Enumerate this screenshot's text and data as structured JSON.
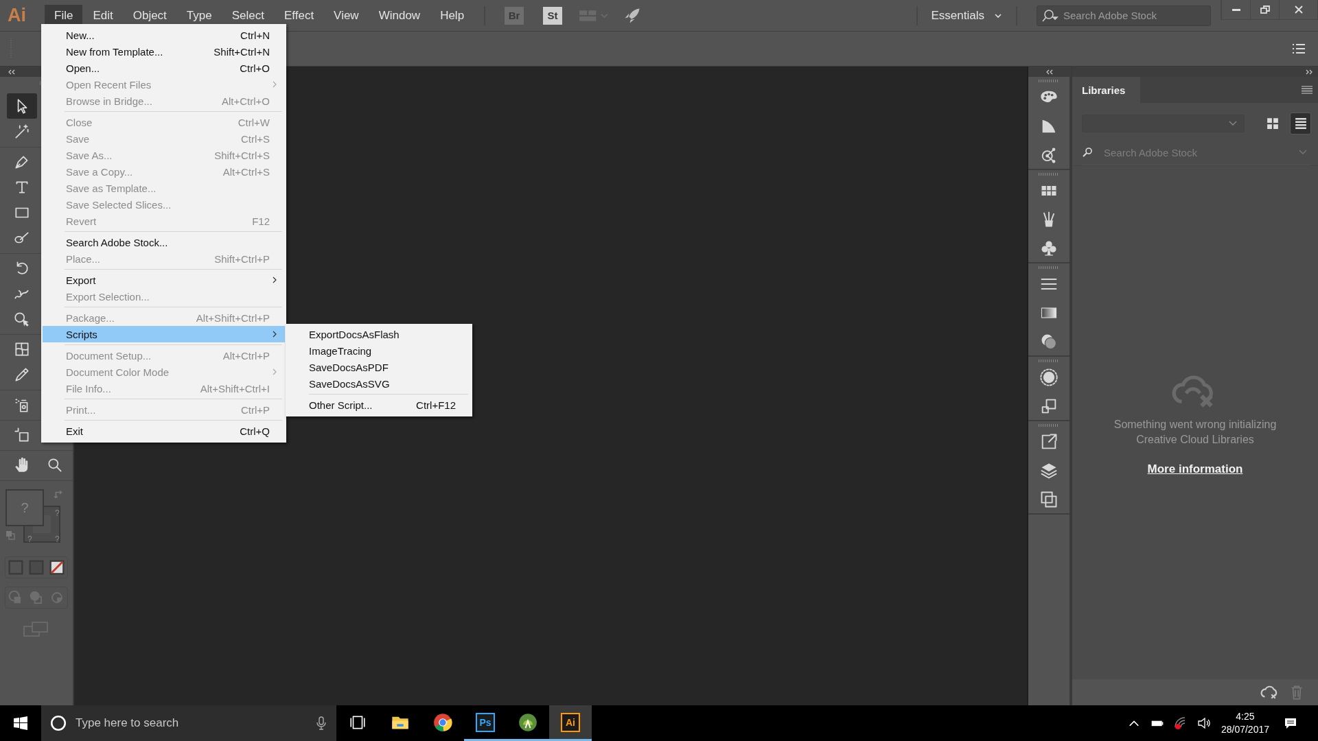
{
  "app_logo": "Ai",
  "menu_bar": [
    {
      "label": "File",
      "selected": true
    },
    {
      "label": "Edit",
      "selected": false
    },
    {
      "label": "Object",
      "selected": false
    },
    {
      "label": "Type",
      "selected": false
    },
    {
      "label": "Select",
      "selected": false
    },
    {
      "label": "Effect",
      "selected": false
    },
    {
      "label": "View",
      "selected": false
    },
    {
      "label": "Window",
      "selected": false
    },
    {
      "label": "Help",
      "selected": false
    }
  ],
  "app_buttons": [
    {
      "label": "Br",
      "disabled": true
    },
    {
      "label": "St",
      "disabled": false
    }
  ],
  "workspace": {
    "label": "Essentials"
  },
  "stock_search": {
    "placeholder": "Search Adobe Stock"
  },
  "tool_groups": [
    [
      {
        "kind": "selection",
        "selected": true
      },
      {
        "kind": "magic-wand",
        "selected": false
      }
    ],
    [
      {
        "kind": "pen",
        "selected": false
      },
      {
        "kind": "type",
        "selected": false
      },
      {
        "kind": "rectangle",
        "selected": false
      },
      {
        "kind": "brush",
        "selected": false
      }
    ],
    [
      {
        "kind": "rotate",
        "selected": false
      },
      {
        "kind": "warp",
        "selected": false
      },
      {
        "kind": "shape-builder",
        "selected": false
      }
    ],
    [
      {
        "kind": "mesh",
        "selected": false
      },
      {
        "kind": "eyedropper",
        "selected": false
      }
    ],
    [
      {
        "kind": "sprayer",
        "selected": false
      }
    ],
    [
      {
        "kind": "artboard",
        "selected": false
      }
    ]
  ],
  "nav_tools": [
    {
      "kind": "hand",
      "selected": false
    },
    {
      "kind": "zoom",
      "selected": false
    }
  ],
  "fill_stroke": {
    "fill_label": "?",
    "stroke_labels": [
      "?",
      "?",
      "?"
    ]
  },
  "file_menu": [
    {
      "kind": "item",
      "label": "New...",
      "shortcut": "Ctrl+N",
      "disabled": false,
      "selected": false
    },
    {
      "kind": "item",
      "label": "New from Template...",
      "shortcut": "Shift+Ctrl+N",
      "disabled": false,
      "selected": false
    },
    {
      "kind": "item",
      "label": "Open...",
      "shortcut": "Ctrl+O",
      "disabled": false,
      "selected": false
    },
    {
      "kind": "submenu",
      "label": "Open Recent Files",
      "disabled": true,
      "selected": false
    },
    {
      "kind": "item",
      "label": "Browse in Bridge...",
      "shortcut": "Alt+Ctrl+O",
      "disabled": true,
      "selected": false
    },
    {
      "kind": "separator"
    },
    {
      "kind": "item",
      "label": "Close",
      "shortcut": "Ctrl+W",
      "disabled": true,
      "selected": false
    },
    {
      "kind": "item",
      "label": "Save",
      "shortcut": "Ctrl+S",
      "disabled": true,
      "selected": false
    },
    {
      "kind": "item",
      "label": "Save As...",
      "shortcut": "Shift+Ctrl+S",
      "disabled": true,
      "selected": false
    },
    {
      "kind": "item",
      "label": "Save a Copy...",
      "shortcut": "Alt+Ctrl+S",
      "disabled": true,
      "selected": false
    },
    {
      "kind": "item",
      "label": "Save as Template...",
      "disabled": true,
      "selected": false
    },
    {
      "kind": "item",
      "label": "Save Selected Slices...",
      "disabled": true,
      "selected": false
    },
    {
      "kind": "item",
      "label": "Revert",
      "shortcut": "F12",
      "disabled": true,
      "selected": false
    },
    {
      "kind": "separator"
    },
    {
      "kind": "item",
      "label": "Search Adobe Stock...",
      "disabled": false,
      "selected": false
    },
    {
      "kind": "item",
      "label": "Place...",
      "shortcut": "Shift+Ctrl+P",
      "disabled": true,
      "selected": false
    },
    {
      "kind": "separator"
    },
    {
      "kind": "submenu",
      "label": "Export",
      "disabled": false,
      "selected": false
    },
    {
      "kind": "item",
      "label": "Export Selection...",
      "disabled": true,
      "selected": false
    },
    {
      "kind": "separator"
    },
    {
      "kind": "item",
      "label": "Package...",
      "shortcut": "Alt+Shift+Ctrl+P",
      "disabled": true,
      "selected": false
    },
    {
      "kind": "submenu",
      "label": "Scripts",
      "disabled": false,
      "selected": true
    },
    {
      "kind": "separator"
    },
    {
      "kind": "item",
      "label": "Document Setup...",
      "shortcut": "Alt+Ctrl+P",
      "disabled": true,
      "selected": false
    },
    {
      "kind": "submenu",
      "label": "Document Color Mode",
      "disabled": true,
      "selected": false
    },
    {
      "kind": "item",
      "label": "File Info...",
      "shortcut": "Alt+Shift+Ctrl+I",
      "disabled": true,
      "selected": false
    },
    {
      "kind": "separator"
    },
    {
      "kind": "item",
      "label": "Print...",
      "shortcut": "Ctrl+P",
      "disabled": true,
      "selected": false
    },
    {
      "kind": "separator"
    },
    {
      "kind": "item",
      "label": "Exit",
      "shortcut": "Ctrl+Q",
      "disabled": false,
      "selected": false
    }
  ],
  "scripts_menu": [
    {
      "kind": "item",
      "label": "ExportDocsAsFlash"
    },
    {
      "kind": "item",
      "label": "ImageTracing"
    },
    {
      "kind": "item",
      "label": "SaveDocsAsPDF"
    },
    {
      "kind": "item",
      "label": "SaveDocsAsSVG"
    },
    {
      "kind": "separator"
    },
    {
      "kind": "item",
      "label": "Other Script...",
      "shortcut": "Ctrl+F12"
    }
  ],
  "dock_groups": [
    [
      {
        "kind": "palette"
      },
      {
        "kind": "fan"
      },
      {
        "kind": "nodes"
      }
    ],
    [
      {
        "kind": "swatches"
      },
      {
        "kind": "brushes"
      },
      {
        "kind": "club"
      }
    ],
    [
      {
        "kind": "lines"
      },
      {
        "kind": "gradient"
      },
      {
        "kind": "circles"
      }
    ],
    [
      {
        "kind": "dotted-circle"
      },
      {
        "kind": "squares"
      }
    ],
    [
      {
        "kind": "export"
      },
      {
        "kind": "layers"
      },
      {
        "kind": "artboards"
      }
    ]
  ],
  "libraries": {
    "tab": "Libraries",
    "search_placeholder": "Search Adobe Stock",
    "view_buttons": [
      {
        "kind": "grid",
        "selected": false
      },
      {
        "kind": "list",
        "selected": true
      }
    ],
    "message_lines": [
      "Something went wrong initializing",
      "Creative Cloud Libraries"
    ],
    "link": "More information"
  },
  "taskbar": {
    "search_placeholder": "Type here to search",
    "apps": [
      {
        "kind": "task-view",
        "running": false,
        "selected": false
      },
      {
        "kind": "folder",
        "running": false,
        "selected": false
      },
      {
        "kind": "browser",
        "running": false,
        "selected": false
      },
      {
        "kind": "badge",
        "label": "Ps",
        "color": "#31a8ff",
        "running": true,
        "selected": false
      },
      {
        "kind": "android",
        "running": true,
        "selected": false
      },
      {
        "kind": "badge",
        "label": "Ai",
        "color": "#ff9a00",
        "running": true,
        "selected": true
      }
    ],
    "time": "4:25",
    "date": "28/07/2017"
  }
}
